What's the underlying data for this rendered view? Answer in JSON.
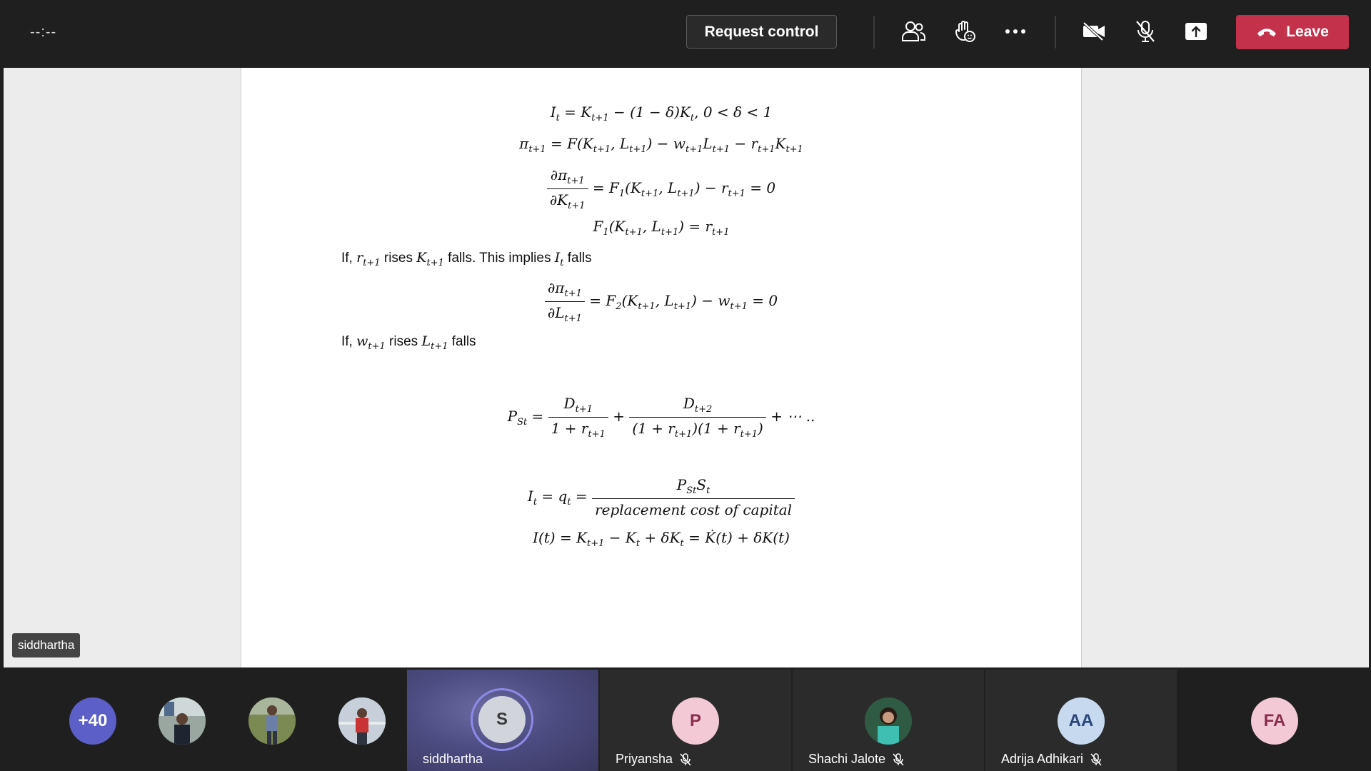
{
  "topbar": {
    "timer": "--:--",
    "request_control": "Request control",
    "leave": "Leave"
  },
  "icons": {
    "participants": "people-icon",
    "raise_hand": "raise-hand-icon",
    "more": "more-icon",
    "camera": "camera-off-icon",
    "mic": "mic-off-icon",
    "share": "share-icon",
    "leave": "phone-hangup-icon"
  },
  "colors": {
    "leave": "#c4314b",
    "active_ring": "#8b8be8",
    "more_badge": "#5b5fc7"
  },
  "presenter_tag": "siddhartha",
  "document": {
    "eq1": "I_t = K_{t+1} − (1 − δ)K_t, 0 < δ < 1",
    "eq2": "π_{t+1} = F(K_{t+1}, L_{t+1}) − w_{t+1}L_{t+1} − r_{t+1}K_{t+1}",
    "line1": "If, r_{t+1} rises K_{t+1} falls. This implies I_t falls",
    "line2": "If, w_{t+1} rises L_{t+1} falls",
    "eq6_den": "replacement cost of capital"
  },
  "participants": {
    "more_count": "+40",
    "tiles": [
      {
        "name": "siddhartha",
        "initials": "S",
        "muted": false,
        "active": true
      },
      {
        "name": "Priyansha",
        "initials": "P",
        "muted": true
      },
      {
        "name": "Shachi Jalote",
        "initials": "",
        "muted": true
      },
      {
        "name": "Adrija Adhikari",
        "initials": "AA",
        "muted": true
      }
    ],
    "last_initials": "FA"
  }
}
